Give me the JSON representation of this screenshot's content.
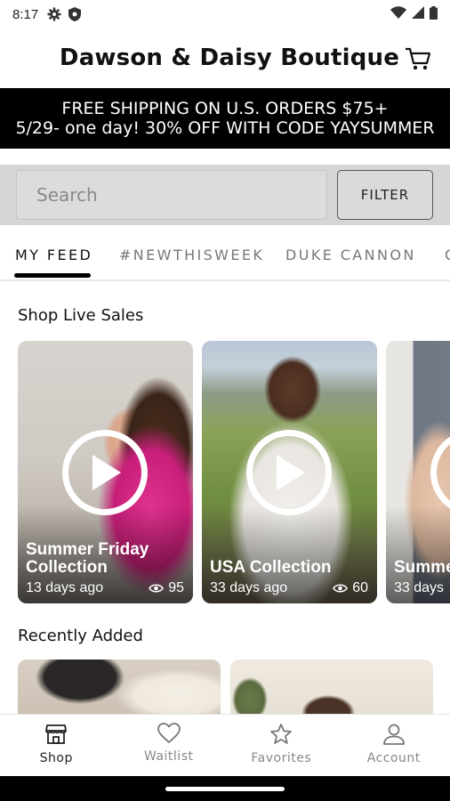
{
  "status_bar": {
    "time": "8:17"
  },
  "header": {
    "title": "Dawson & Daisy Boutique"
  },
  "promo": {
    "line1": "FREE SHIPPING ON U.S. ORDERS $75+",
    "line2": "5/29- one day! 30% OFF WITH CODE YAYSUMMER"
  },
  "search": {
    "placeholder": "Search",
    "filter_label": "FILTER"
  },
  "tabs": [
    {
      "label": "MY FEED",
      "active": true
    },
    {
      "label": "#NEWTHISWEEK",
      "active": false
    },
    {
      "label": "DUKE CANNON",
      "active": false
    },
    {
      "label": "C",
      "active": false
    }
  ],
  "live_sales": {
    "title": "Shop Live Sales",
    "cards": [
      {
        "title": "Summer Friday Collection",
        "age": "13 days ago",
        "views": "95"
      },
      {
        "title": "USA Collection",
        "age": "33 days ago",
        "views": "60"
      },
      {
        "title": "Summer Live",
        "age": "33 days",
        "views": ""
      }
    ]
  },
  "recently_added": {
    "title": "Recently Added"
  },
  "bottom_nav": [
    {
      "label": "Shop",
      "icon": "storefront-icon",
      "active": true
    },
    {
      "label": "Waitlist",
      "icon": "heart-icon",
      "active": false
    },
    {
      "label": "Favorites",
      "icon": "star-icon",
      "active": false
    },
    {
      "label": "Account",
      "icon": "person-icon",
      "active": false
    }
  ],
  "colors": {
    "banner_bg": "#000000",
    "search_bg": "#d6d6d6",
    "active_tab": "#111111",
    "inactive_tab": "#777777"
  }
}
